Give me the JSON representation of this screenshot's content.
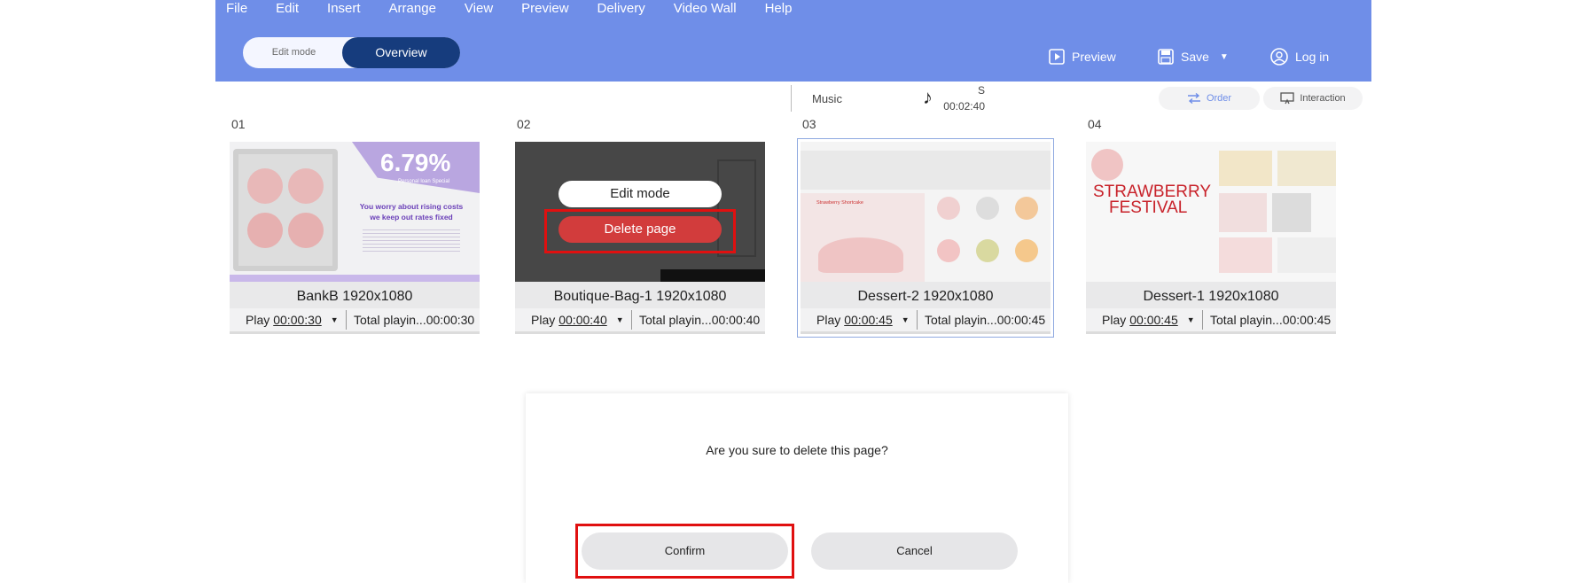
{
  "menu": [
    "File",
    "Edit",
    "Insert",
    "Arrange",
    "View",
    "Preview",
    "Delivery",
    "Video Wall",
    "Help"
  ],
  "mode": {
    "edit_label": "Edit mode",
    "overview_label": "Overview"
  },
  "header_actions": {
    "preview": "Preview",
    "save": "Save",
    "login": "Log in"
  },
  "info": {
    "s_label": "S",
    "duration": "00:02:40",
    "music": "Music",
    "order": "Order",
    "interaction": "Interaction"
  },
  "pages": [
    {
      "num": "01",
      "name": "BankB 1920x1080",
      "play_label": "Play",
      "play_time": "00:00:30",
      "total": "Total playin...00:00:30",
      "thumb": {
        "big": "6.79%",
        "small": "Personal loan Special",
        "line1": "You worry about rising costs",
        "line2": "we keep out rates fixed"
      }
    },
    {
      "num": "02",
      "name": "Boutique-Bag-1 1920x1080",
      "play_label": "Play",
      "play_time": "00:00:40",
      "total": "Total playin...00:00:40",
      "overlay": {
        "edit": "Edit mode",
        "delete": "Delete page"
      }
    },
    {
      "num": "03",
      "name": "Dessert-2 1920x1080",
      "play_label": "Play",
      "play_time": "00:00:45",
      "total": "Total playin...00:00:45",
      "thumb": {
        "small": "Strawberry Shortcake"
      }
    },
    {
      "num": "04",
      "name": "Dessert-1 1920x1080",
      "play_label": "Play",
      "play_time": "00:00:45",
      "total": "Total playin...00:00:45",
      "thumb": {
        "line1": "STRAWBERRY",
        "line2": "FESTIVAL"
      }
    }
  ],
  "dialog": {
    "message": "Are you sure to delete this page?",
    "confirm": "Confirm",
    "cancel": "Cancel"
  },
  "colors": {
    "header": "#6f8ee8",
    "overview_active": "#163c7d",
    "delete_red": "#d23c3c",
    "highlight": "#e01010"
  }
}
